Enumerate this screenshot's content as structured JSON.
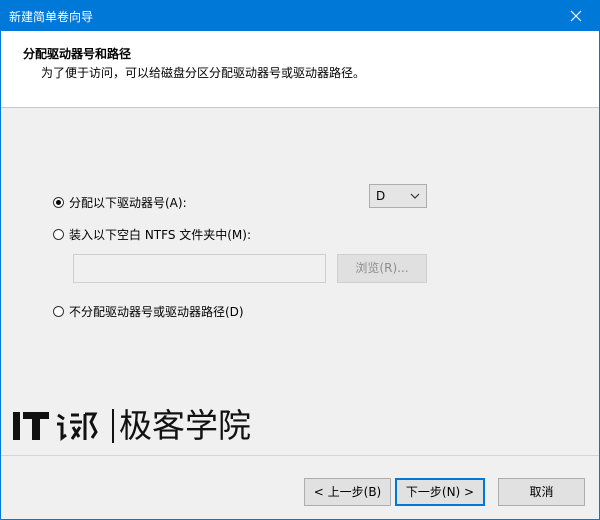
{
  "window": {
    "title": "新建简单卷向导"
  },
  "header": {
    "title": "分配驱动器号和路径",
    "subtitle": "为了便于访问，可以给磁盘分区分配驱动器号或驱动器路径。"
  },
  "options": {
    "assign_letter": {
      "label": "分配以下驱动器号(A):",
      "checked": true
    },
    "drive_letter": {
      "value": "D"
    },
    "mount_folder": {
      "label": "装入以下空白 NTFS 文件夹中(M):",
      "checked": false
    },
    "folder_path": {
      "value": ""
    },
    "browse_label": "浏览(R)...",
    "no_assign": {
      "label": "不分配驱动器号或驱动器路径(D)",
      "checked": false
    }
  },
  "watermark": {
    "text": "极客学院"
  },
  "footer": {
    "back_label": "< 上一步(B)",
    "next_label": "下一步(N) >",
    "cancel_label": "取消"
  },
  "colors": {
    "titlebar": "#0078d7",
    "background": "#f0f0f0"
  },
  "icons": [
    "close-icon",
    "chevron-down-icon",
    "it-logo-icon"
  ]
}
